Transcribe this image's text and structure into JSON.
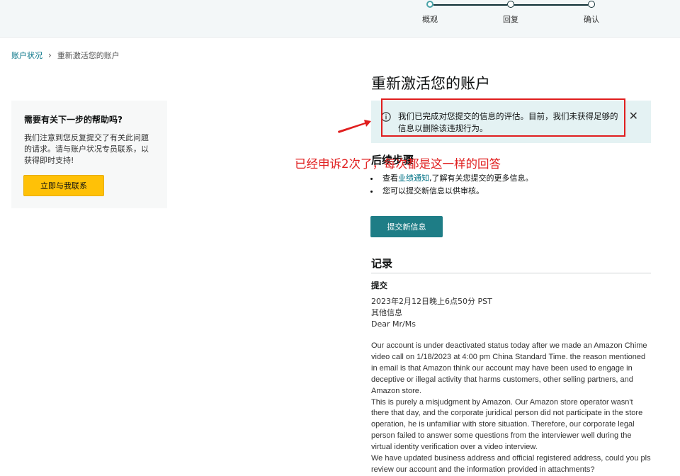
{
  "steps": [
    {
      "label": "概观",
      "active": true
    },
    {
      "label": "回复",
      "active": false
    },
    {
      "label": "确认",
      "active": false
    }
  ],
  "breadcrumb": {
    "parent": "账户状况",
    "current": "重新激活您的账户"
  },
  "help": {
    "title": "需要有关下一步的帮助吗?",
    "text": "我们注意到您反复提交了有关此问题的请求。请与账户状况专员联系，以获得即时支持!",
    "button": "立即与我联系"
  },
  "main": {
    "title": "重新激活您的账户",
    "alert": "我们已完成对您提交的信息的评估。目前，我们未获得足够的信息以删除该违规行为。",
    "annotation": "已经申诉2次了，每次都是这一样的回答",
    "next_steps": {
      "title": "后续步骤",
      "item1_prefix": "查看",
      "item1_link": "业绩通知",
      "item1_suffix": ",了解有关您提交的更多信息。",
      "item2": "您可以提交新信息以供审核。"
    },
    "submit_button": "提交新信息"
  },
  "record": {
    "title": "记录",
    "section": "提交",
    "timestamp": "2023年2月12日晚上6点50分 PST",
    "type": "其他信息",
    "greeting": "Dear Mr/Ms",
    "para1": "Our account is under deactivated status today after we made an Amazon Chime video call on 1/18/2023 at 4:00 pm China Standard Time. the reason mentioned in email is that Amazon think our account may have been used to engage in deceptive or illegal activity that harms customers, other selling partners, and Amazon store.",
    "para2": "This is purely a misjudgment by Amazon. Our Amazon store operator wasn't there that day, and the corporate juridical person did not participate in the store operation, he is unfamiliar with store situation. Therefore, our corporate legal person failed to answer some questions from the interviewer well during the virtual identity verification over a video interview.",
    "para3": "We have updated business address and official registered address, could you pls review our account and the information provided in attachments?"
  },
  "colors": {
    "accent": "#007185",
    "primary_button": "#1e7d86",
    "help_button": "#ffc107",
    "annotation": "#e02020",
    "alert_bg": "#e4f2f3"
  }
}
